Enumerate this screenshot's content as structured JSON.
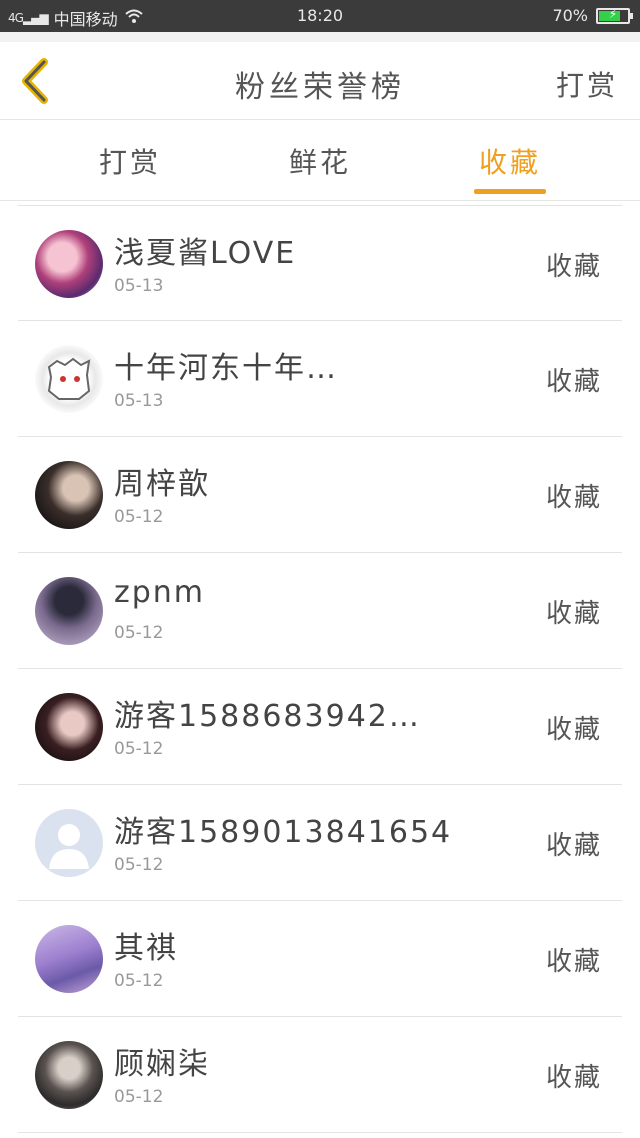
{
  "status_bar": {
    "signal": "4G",
    "carrier": "中国移动",
    "time": "18:20",
    "battery": "70%",
    "battery_level": 0.7
  },
  "header": {
    "title": "粉丝荣誉榜",
    "right_action": "打赏"
  },
  "tabs": [
    {
      "label": "打赏",
      "active": false
    },
    {
      "label": "鲜花",
      "active": false
    },
    {
      "label": "收藏",
      "active": true
    }
  ],
  "list": [
    {
      "name": "浅夏酱LOVE",
      "date": "05-13",
      "action": "收藏"
    },
    {
      "name": "十年河东十年…",
      "date": "05-13",
      "action": "收藏"
    },
    {
      "name": "周梓歆",
      "date": "05-12",
      "action": "收藏"
    },
    {
      "name": "zpnm",
      "date": "05-12",
      "action": "收藏"
    },
    {
      "name": "游客1588683942…",
      "date": "05-12",
      "action": "收藏"
    },
    {
      "name": "游客15890138416​54",
      "date": "05-12",
      "action": "收藏"
    },
    {
      "name": "其祺",
      "date": "05-12",
      "action": "收藏"
    },
    {
      "name": "顾娴柒",
      "date": "05-12",
      "action": "收藏"
    }
  ],
  "colors": {
    "accent": "#f0a020",
    "status_bar": "#3b3b3b"
  }
}
